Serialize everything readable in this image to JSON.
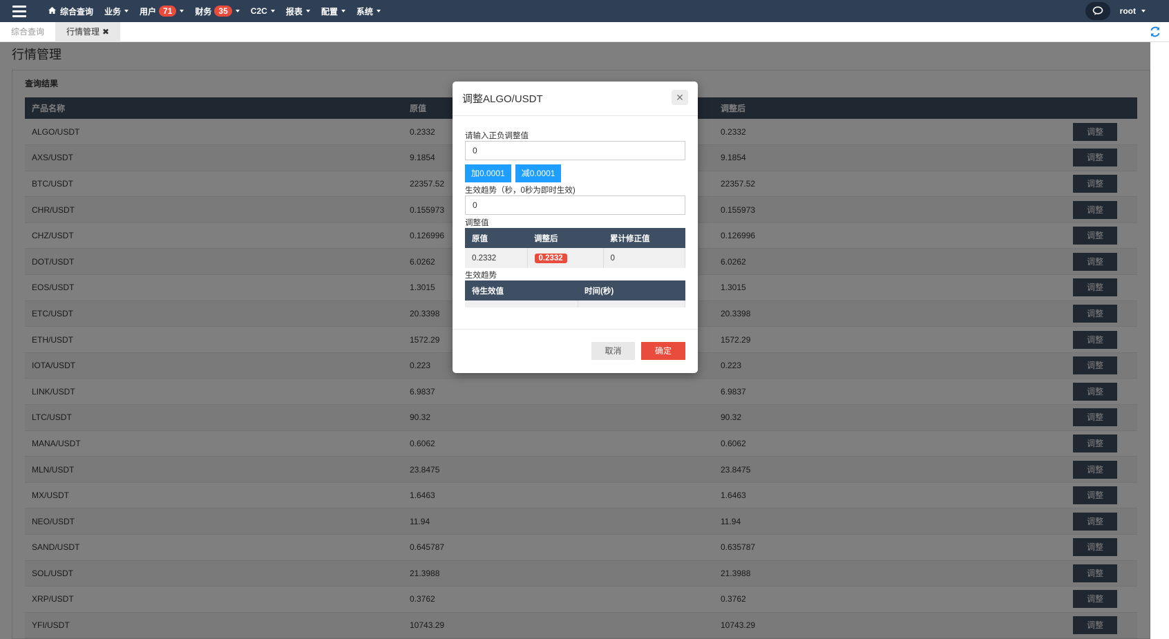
{
  "nav": {
    "items": [
      {
        "label": "综合查询",
        "icon": "home-icon",
        "caret": false
      },
      {
        "label": "业务",
        "caret": true
      },
      {
        "label": "用户",
        "badge": "71",
        "caret": true
      },
      {
        "label": "财务",
        "badge": "35",
        "caret": true
      },
      {
        "label": "C2C",
        "caret": true
      },
      {
        "label": "报表",
        "caret": true
      },
      {
        "label": "配置",
        "caret": true
      },
      {
        "label": "系统",
        "caret": true
      }
    ],
    "user": "root"
  },
  "tabs": [
    {
      "label": "综合查询",
      "active": false
    },
    {
      "label": "行情管理",
      "active": true,
      "close": "✖"
    }
  ],
  "page": {
    "title": "行情管理",
    "section": "查询结果"
  },
  "table": {
    "headers": [
      "产品名称",
      "原值",
      "调整后",
      ""
    ],
    "button_label": "调整",
    "rows": [
      [
        "ALGO/USDT",
        "0.2332",
        "0.2332"
      ],
      [
        "AXS/USDT",
        "9.1854",
        "9.1854"
      ],
      [
        "BTC/USDT",
        "22357.52",
        "22357.52"
      ],
      [
        "CHR/USDT",
        "0.155973",
        "0.155973"
      ],
      [
        "CHZ/USDT",
        "0.126996",
        "0.126996"
      ],
      [
        "DOT/USDT",
        "6.0262",
        "6.0262"
      ],
      [
        "EOS/USDT",
        "1.3015",
        "1.3015"
      ],
      [
        "ETC/USDT",
        "20.3398",
        "20.3398"
      ],
      [
        "ETH/USDT",
        "1572.29",
        "1572.29"
      ],
      [
        "IOTA/USDT",
        "0.223",
        "0.223"
      ],
      [
        "LINK/USDT",
        "6.9837",
        "6.9837"
      ],
      [
        "LTC/USDT",
        "90.32",
        "90.32"
      ],
      [
        "MANA/USDT",
        "0.6062",
        "0.6062"
      ],
      [
        "MLN/USDT",
        "23.8475",
        "23.8475"
      ],
      [
        "MX/USDT",
        "1.6463",
        "1.6463"
      ],
      [
        "NEO/USDT",
        "11.94",
        "11.94"
      ],
      [
        "SAND/USDT",
        "0.645787",
        "0.635787"
      ],
      [
        "SOL/USDT",
        "21.3988",
        "21.3988"
      ],
      [
        "XRP/USDT",
        "0.3762",
        "0.3762"
      ],
      [
        "YFI/USDT",
        "10743.29",
        "10743.29"
      ]
    ]
  },
  "modal": {
    "title": "调整ALGO/USDT",
    "close": "✕",
    "adjust_label": "请输入正负调整值",
    "adjust_value": "0",
    "plus_btn": "加0.0001",
    "minus_btn": "减0.0001",
    "trend_label": "生效趋势（秒，0秒为即时生效)",
    "trend_value": "0",
    "adj_table_label": "调整值",
    "adj_headers": [
      "原值",
      "调整后",
      "累计修正值"
    ],
    "adj_row": [
      "0.2332",
      "0.2332",
      "0"
    ],
    "trend_table_label": "生效趋势",
    "trend_headers": [
      "待生效值",
      "时间(秒)"
    ],
    "cancel": "取消",
    "confirm": "确定"
  },
  "colors": {
    "navbar": "#2f4056",
    "table_header": "#3e4f63",
    "badge": "#e94b3c",
    "primary_blue": "#1e9fff",
    "refresh": "#1e88e5"
  }
}
